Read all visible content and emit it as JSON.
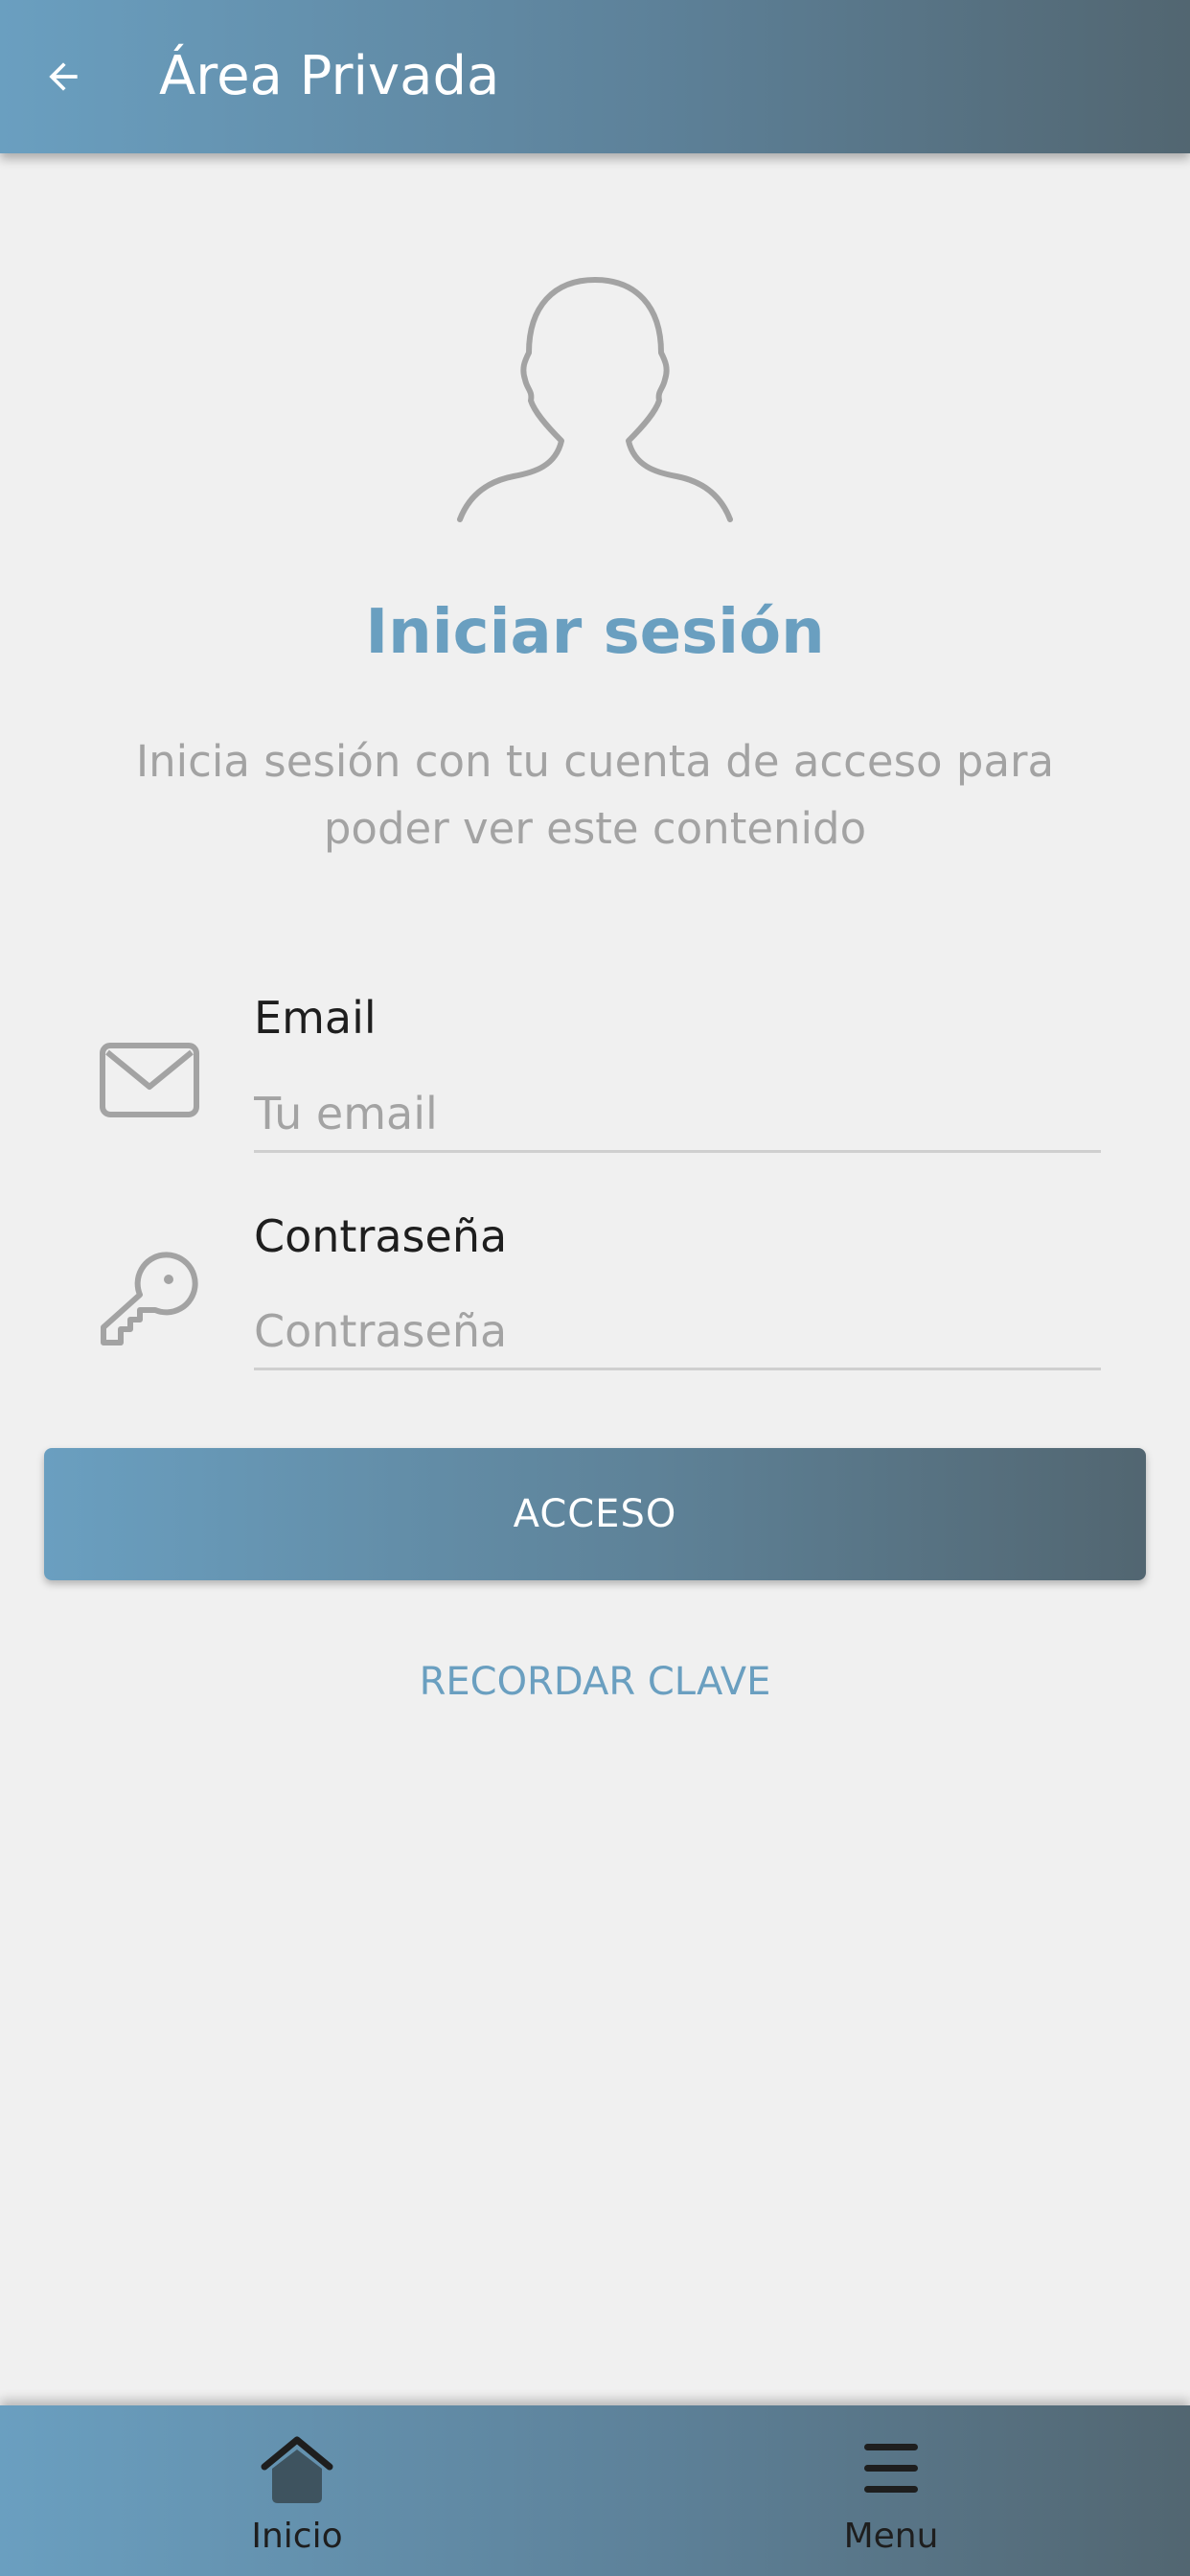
{
  "header": {
    "title": "Área Privada",
    "back_icon": "arrow-left-icon"
  },
  "login": {
    "avatar_icon": "user-silhouette-icon",
    "title": "Iniciar sesión",
    "subtitle": "Inicia sesión con tu cuenta de acceso para poder ver este contenido"
  },
  "form": {
    "email": {
      "icon": "envelope-icon",
      "label": "Email",
      "placeholder": "Tu email",
      "value": ""
    },
    "password": {
      "icon": "key-icon",
      "label": "Contraseña",
      "placeholder": "Contraseña",
      "value": ""
    },
    "submit_label": "ACCESO",
    "remember_label": "RECORDAR CLAVE"
  },
  "bottom_nav": {
    "items": [
      {
        "label": "Inicio",
        "icon": "home-icon"
      },
      {
        "label": "Menu",
        "icon": "hamburger-menu-icon"
      }
    ]
  },
  "colors": {
    "accent": "#6a9fc0",
    "gradient_end": "#526671",
    "background": "#f0f0f0",
    "muted_text": "#a3a3a3"
  }
}
